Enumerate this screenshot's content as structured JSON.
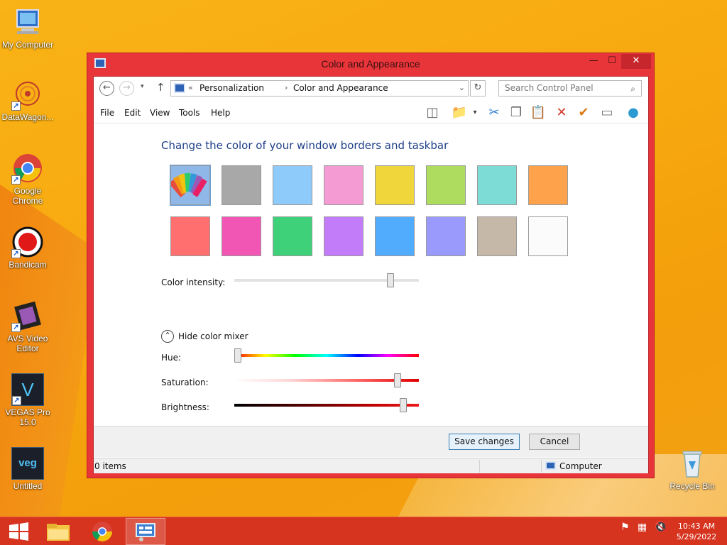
{
  "desktop": {
    "icons": [
      {
        "label": "My Computer"
      },
      {
        "label": "DataWagon..."
      },
      {
        "label": "Google Chrome"
      },
      {
        "label": "Bandicam"
      },
      {
        "label": "AVS Video Editor"
      },
      {
        "label": "VEGAS Pro 15.0"
      },
      {
        "label": "Untitled"
      },
      {
        "label": "Recycle Bin"
      }
    ],
    "vegas_glyph": "V",
    "veg_glyph": "veg"
  },
  "window": {
    "title": "Color and Appearance",
    "controls": {
      "minimize": "—",
      "maximize": "☐",
      "close": "✕"
    }
  },
  "address": {
    "nav": {
      "back": "←",
      "forward": "→",
      "dropdown": "▾",
      "up": "↑",
      "refresh": "↻"
    },
    "sep_root": "«",
    "crumbs": [
      "Personalization",
      "Color and Appearance"
    ],
    "crumb_sep": "›",
    "dropdown": "⌄",
    "search_placeholder": "Search Control Panel",
    "search_icon": "⌕"
  },
  "menu": {
    "items": [
      "File",
      "Edit",
      "View",
      "Tools",
      "Help"
    ]
  },
  "toolbar": {
    "icons": [
      {
        "name": "pane-layout-icon",
        "glyph": "◫",
        "color": "#666666"
      },
      {
        "name": "folder-options-icon",
        "glyph": "📁",
        "color": "#d9a520"
      },
      {
        "name": "folder-dropdown-icon",
        "glyph": "▾",
        "color": "#444444"
      },
      {
        "name": "cut-icon",
        "glyph": "✂",
        "color": "#3a7fd0"
      },
      {
        "name": "copy-icon",
        "glyph": "❐",
        "color": "#666666"
      },
      {
        "name": "paste-icon",
        "glyph": "📋",
        "color": "#8a6a3a"
      },
      {
        "name": "delete-icon",
        "glyph": "✕",
        "color": "#d23a2a"
      },
      {
        "name": "checkmark-icon",
        "glyph": "✔",
        "color": "#e07a16"
      },
      {
        "name": "properties-icon",
        "glyph": "▭",
        "color": "#7a7a7a"
      },
      {
        "name": "shell-icon",
        "glyph": "●",
        "color": "#2a9ad0"
      }
    ]
  },
  "content": {
    "heading": "Change the color of your window borders and taskbar",
    "swatches": [
      {
        "name": "swatch-auto",
        "color": "#8fb8e8",
        "selected": true
      },
      {
        "name": "swatch-gray",
        "color": "#a8a8a8"
      },
      {
        "name": "swatch-light-blue",
        "color": "#8ecbfa"
      },
      {
        "name": "swatch-pink",
        "color": "#f59bd4"
      },
      {
        "name": "swatch-yellow",
        "color": "#f0d63a"
      },
      {
        "name": "swatch-lime",
        "color": "#addc5e"
      },
      {
        "name": "swatch-teal",
        "color": "#7dddd6"
      },
      {
        "name": "swatch-orange",
        "color": "#fea34b"
      },
      {
        "name": "swatch-red",
        "color": "#ff6f6f"
      },
      {
        "name": "swatch-magenta",
        "color": "#f156b5"
      },
      {
        "name": "swatch-green",
        "color": "#3fd07a"
      },
      {
        "name": "swatch-purple",
        "color": "#c27cf9"
      },
      {
        "name": "swatch-blue",
        "color": "#52acfd"
      },
      {
        "name": "swatch-periwinkle",
        "color": "#9a99fc"
      },
      {
        "name": "swatch-taupe",
        "color": "#c6b8a9"
      },
      {
        "name": "swatch-white",
        "color": "#fbfbfb"
      }
    ],
    "intensity_label": "Color intensity:",
    "intensity_value": 0.86,
    "mixer_toggle": "Hide color mixer",
    "mixer_toggle_icon": "⌃",
    "hue_label": "Hue:",
    "hue_value": 0.0,
    "saturation_label": "Saturation:",
    "saturation_value": 0.9,
    "brightness_label": "Brightness:",
    "brightness_value": 0.93
  },
  "footer": {
    "save": "Save changes",
    "cancel": "Cancel"
  },
  "status": {
    "items": "0 items",
    "location": "Computer"
  },
  "taskbar": {
    "tray": {
      "flag": "⚑",
      "network": "▦",
      "volume": "🔇"
    },
    "time": "10:43 AM",
    "date": "5/29/2022"
  },
  "colors": {
    "accent": "#e8353a",
    "taskbar": "#d6341f",
    "heading": "#1e3f87"
  }
}
